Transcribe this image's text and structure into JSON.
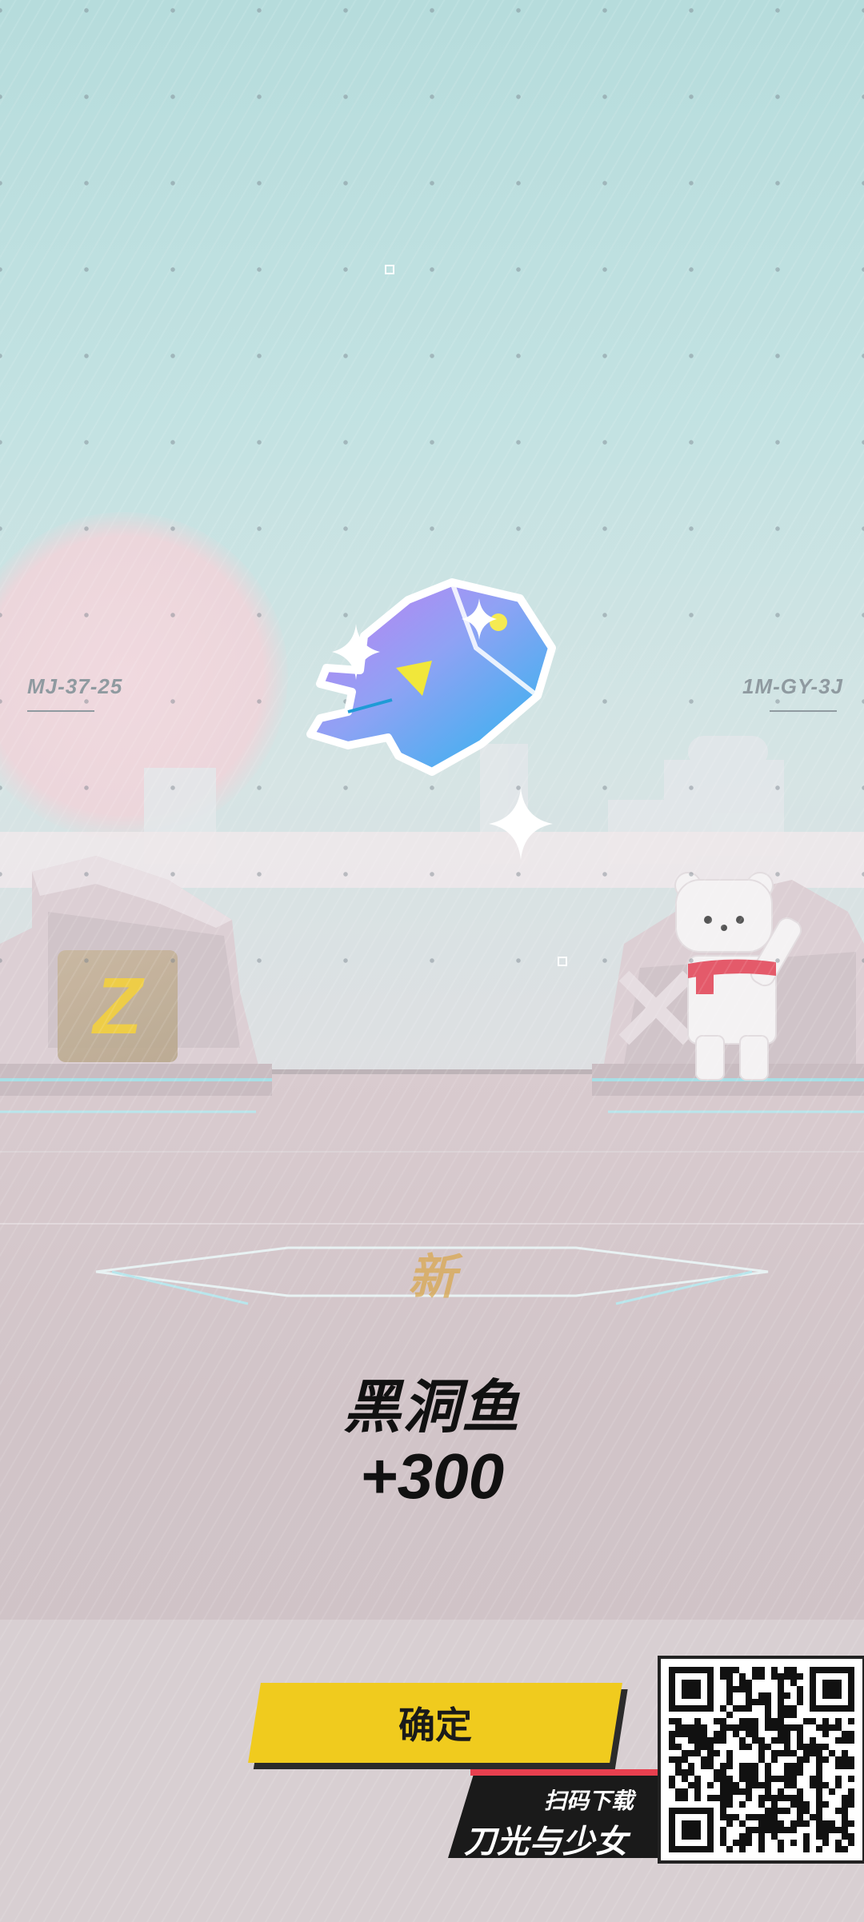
{
  "scene": {
    "left_code": "MJ-37-25",
    "right_code": "1M-GY-3J",
    "z_badge_letter": "Z"
  },
  "reward": {
    "new_label": "新",
    "item_name": "黑洞鱼",
    "item_count": "+300",
    "item_icon": "fish-icon"
  },
  "confirm": {
    "label": "确定"
  },
  "promo": {
    "scan_label": "扫码下载",
    "game_title": "刀光与少女",
    "qr_icon": "qr-code-icon"
  },
  "colors": {
    "confirm_yellow": "#f0cb1e",
    "fish_blue": "#2eb8f0",
    "fish_purple": "#b47cf0",
    "promo_red": "#e8404f"
  }
}
